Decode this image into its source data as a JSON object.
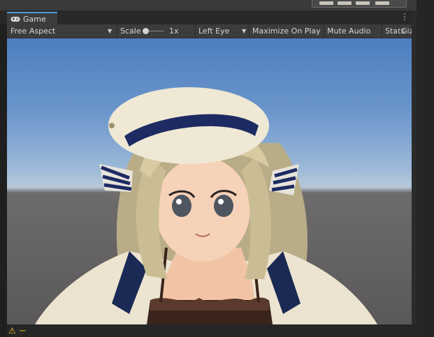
{
  "window": {
    "tab": {
      "label": "Game",
      "icon": "gamepad-icon"
    },
    "menu_icon": "kebab-icon"
  },
  "toolbar": {
    "aspect": {
      "label": "Free Aspect",
      "icon": "dropdown-arrow-icon"
    },
    "scale": {
      "label": "Scale",
      "value": "1x"
    },
    "eye": {
      "label": "Left Eye",
      "icon": "dropdown-arrow-icon"
    },
    "maximize_label": "Maximize On Play",
    "mute_label": "Mute Audio",
    "stats_label": "Stats",
    "gizmos_label": "Giz"
  },
  "console": {
    "icon": "warning-icon",
    "message": "ー"
  },
  "colors": {
    "sky_top": "#4e7ec0",
    "horizon": "#b8c9d9",
    "ground": "#5a5858",
    "accent_tab": "#4d9ad8",
    "warning": "#e3c21a"
  }
}
